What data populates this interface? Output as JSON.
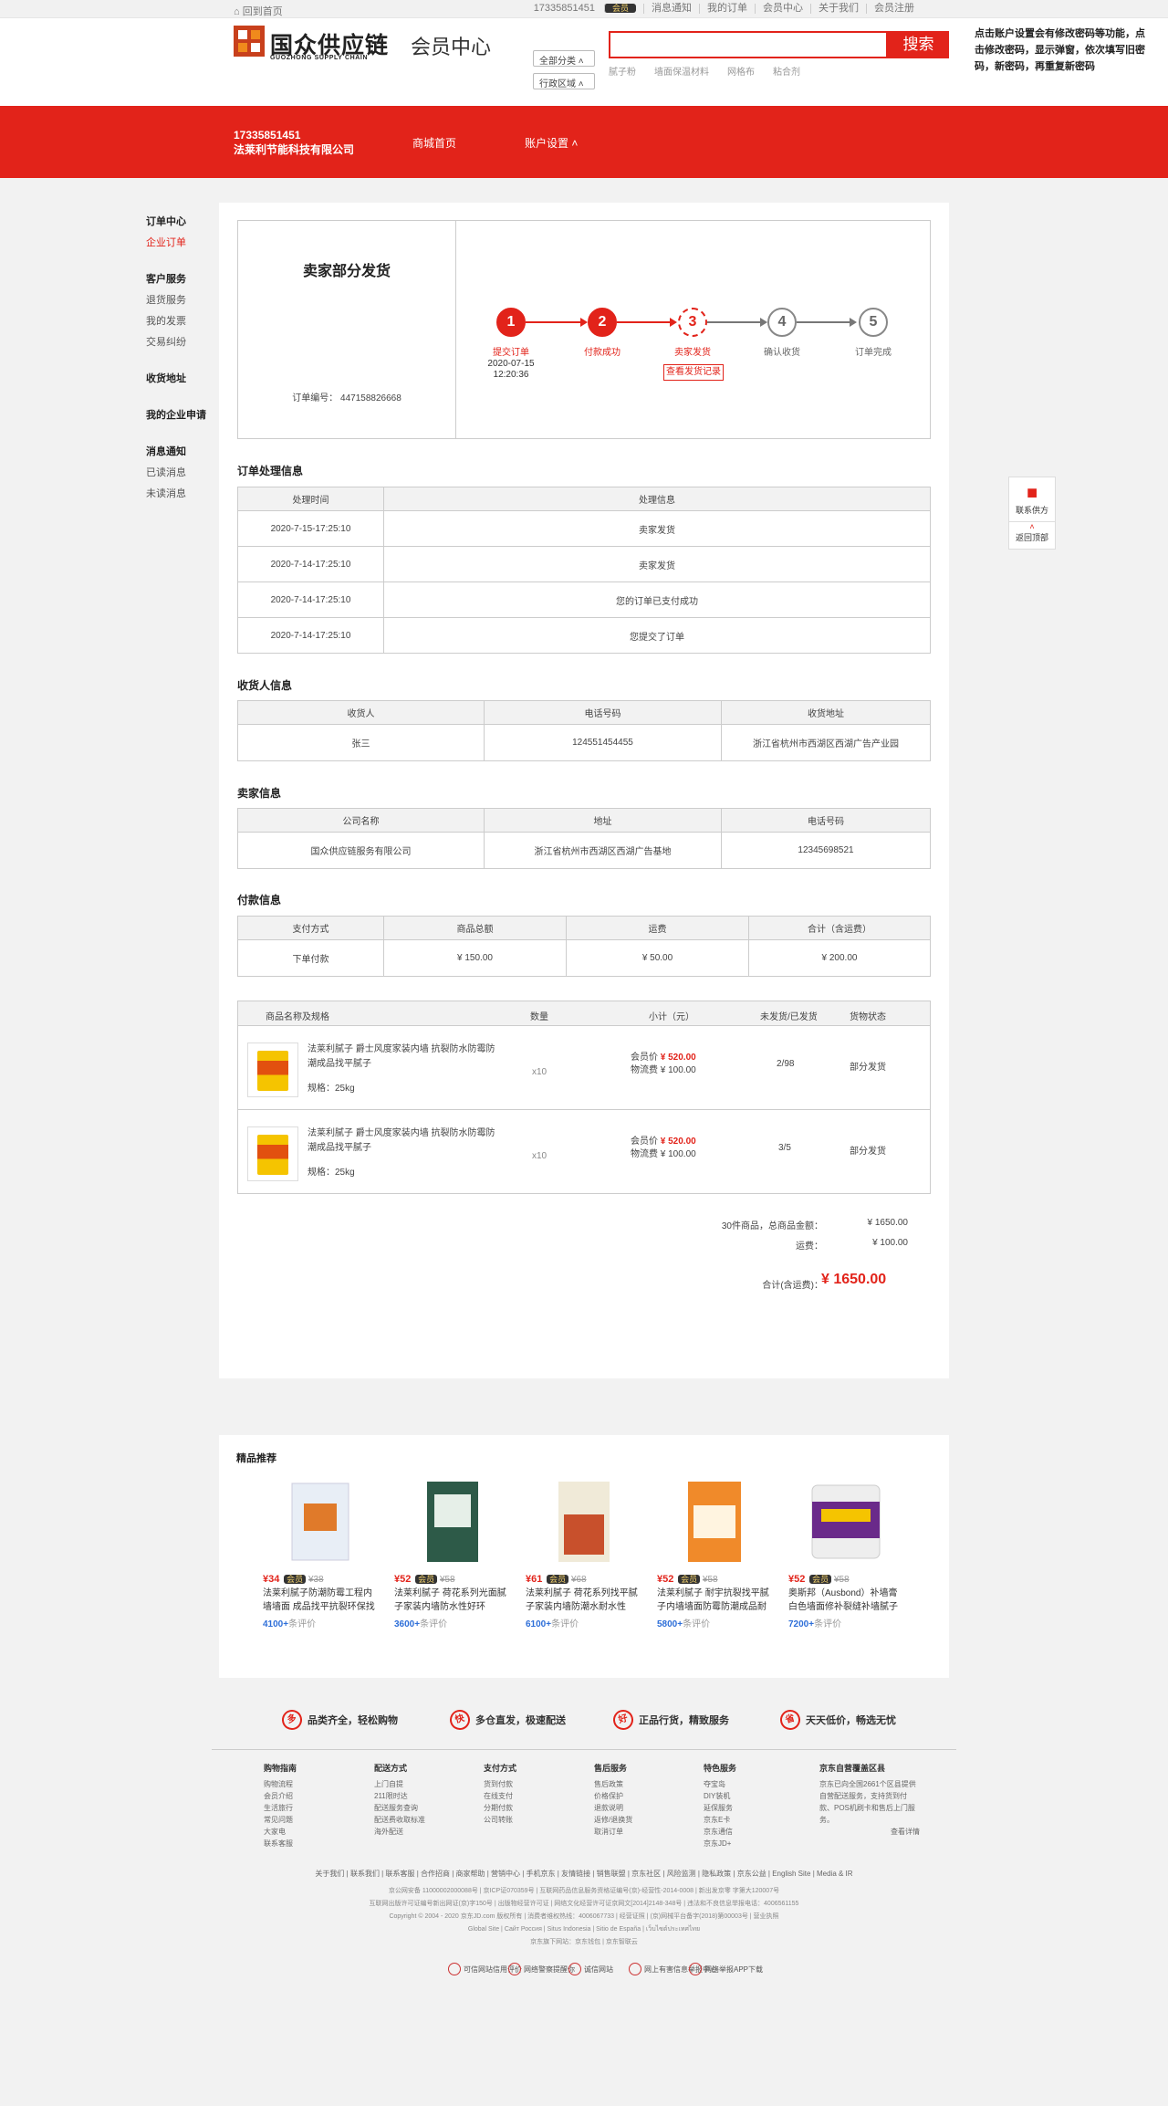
{
  "topbar": {
    "home": "回到首页",
    "phone": "17335851451",
    "vip": "会员",
    "links": [
      "消息通知",
      "我的订单",
      "会员中心",
      "关于我们",
      "会员注册"
    ]
  },
  "header": {
    "logo_cn": "国众供应链",
    "logo_en": "GUOZHONG SUPPLY CHAIN",
    "title": "会员中心",
    "select1": "全部分类",
    "select2": "行政区域",
    "search_btn": "搜索",
    "search_placeholder": "",
    "hot": [
      "腻子粉",
      "墙面保温材料",
      "网格布",
      "粘合剂"
    ],
    "note": "点击账户设置会有修改密码等功能，点击修改密码，显示弹窗，依次填写旧密码，新密码，再重复新密码"
  },
  "account": {
    "phone": "17335851451",
    "company": "法莱利节能科技有限公司",
    "nav": [
      "商城首页",
      "账户设置"
    ]
  },
  "sidebar": [
    {
      "head": "订单中心",
      "items": [
        "企业订单"
      ]
    },
    {
      "head": "客户服务",
      "items": [
        "退货服务",
        "我的发票",
        "交易纠纷"
      ]
    },
    {
      "head": "收货地址",
      "items": []
    },
    {
      "head": "我的企业申请",
      "items": []
    },
    {
      "head": "消息通知",
      "items": [
        "已读消息",
        "未读消息"
      ]
    }
  ],
  "order": {
    "status": "卖家部分发货",
    "order_no_label": "订单编号：",
    "order_no": "447158826668",
    "steps": [
      {
        "n": "1",
        "label": "提交订单"
      },
      {
        "n": "2",
        "label": "付款成功"
      },
      {
        "n": "3",
        "label": "卖家发货"
      },
      {
        "n": "4",
        "label": "确认收货"
      },
      {
        "n": "5",
        "label": "订单完成"
      }
    ],
    "step1_date": "2020-07-15",
    "step1_time": "12:20:36",
    "log_btn": "查看发货记录"
  },
  "process": {
    "title": "订单处理信息",
    "headers": [
      "处理时间",
      "处理信息"
    ],
    "rows": [
      [
        "2020-7-15-17:25:10",
        "卖家发货"
      ],
      [
        "2020-7-14-17:25:10",
        "卖家发货"
      ],
      [
        "2020-7-14-17:25:10",
        "您的订单已支付成功"
      ],
      [
        "2020-7-14-17:25:10",
        "您提交了订单"
      ]
    ]
  },
  "receiver": {
    "title": "收货人信息",
    "headers": [
      "收货人",
      "电话号码",
      "收货地址"
    ],
    "row": [
      "张三",
      "124551454455",
      "浙江省杭州市西湖区西湖广告产业园"
    ]
  },
  "seller": {
    "title": "卖家信息",
    "headers": [
      "公司名称",
      "地址",
      "电话号码"
    ],
    "row": [
      "国众供应链服务有限公司",
      "浙江省杭州市西湖区西湖广告基地",
      "12345698521"
    ]
  },
  "payment": {
    "title": "付款信息",
    "headers": [
      "支付方式",
      "商品总额",
      "运费",
      "合计（含运费）"
    ],
    "row": [
      "下单付款",
      "¥ 150.00",
      "¥ 50.00",
      "¥ 200.00"
    ]
  },
  "products": {
    "headers": [
      "商品名称及规格",
      "数量",
      "小计（元）",
      "未发货/已发货",
      "货物状态"
    ],
    "items": [
      {
        "name": "法莱利腻子 爵士风度家装内墙 抗裂防水防霉防潮成品找平腻子",
        "spec": "规格：25kg",
        "qty": "x10",
        "member_label": "会员价",
        "member_price": "¥ 520.00",
        "logistics_label": "物流费",
        "logistics": "¥ 100.00",
        "ship": "2/98",
        "status": "部分发货"
      },
      {
        "name": "法莱利腻子 爵士风度家装内墙 抗裂防水防霉防潮成品找平腻子",
        "spec": "规格：25kg",
        "qty": "x10",
        "member_label": "会员价",
        "member_price": "¥ 520.00",
        "logistics_label": "物流费",
        "logistics": "¥ 100.00",
        "ship": "3/5",
        "status": "部分发货"
      }
    ]
  },
  "summary": {
    "goods_label": "30件商品，总商品金额：",
    "goods": "¥ 1650.00",
    "freight_label": "运费：",
    "freight": "¥ 100.00",
    "total_label": "合计(含运费)：",
    "total": "¥ 1650.00"
  },
  "recommend": {
    "title": "精品推荐",
    "items": [
      {
        "price": "¥34",
        "old_price": "¥38",
        "name": "法莱利腻子防潮防霉工程内墙墙面 成品找平抗裂环保找平",
        "count": "4100+",
        "count_label": "条评价"
      },
      {
        "price": "¥52",
        "old_price": "¥58",
        "name": "法莱利腻子 荷花系列光面腻子家装内墙防水性好环",
        "count": "3600+",
        "count_label": "条评价"
      },
      {
        "price": "¥61",
        "old_price": "¥68",
        "name": "法莱利腻子 荷花系列找平腻子家装内墙防潮水耐水性",
        "count": "6100+",
        "count_label": "条评价"
      },
      {
        "price": "¥52",
        "old_price": "¥58",
        "name": "法莱利腻子 耐宇抗裂找平腻子内墙墙面防霉防潮成品耐",
        "count": "5800+",
        "count_label": "条评价"
      },
      {
        "price": "¥52",
        "old_price": "¥58",
        "name": "奥斯邦（Ausbond）补墙膏 白色墙面修补裂缝补墙腻子膏粉刷",
        "count": "7200+",
        "count_label": "条评价"
      }
    ],
    "vip": "会员"
  },
  "promises": [
    {
      "icon": "多",
      "text": "品类齐全，轻松购物"
    },
    {
      "icon": "快",
      "text": "多仓直发，极速配送"
    },
    {
      "icon": "好",
      "text": "正品行货，精致服务"
    },
    {
      "icon": "省",
      "text": "天天低价，畅选无忧"
    }
  ],
  "footer_cols": [
    {
      "h": "购物指南",
      "items": [
        "购物流程",
        "会员介绍",
        "生活旅行",
        "常见问题",
        "大家电",
        "联系客服"
      ]
    },
    {
      "h": "配送方式",
      "items": [
        "上门自提",
        "211限时达",
        "配送服务查询",
        "配送费收取标准",
        "海外配送"
      ]
    },
    {
      "h": "支付方式",
      "items": [
        "货到付款",
        "在线支付",
        "分期付款",
        "公司转账"
      ]
    },
    {
      "h": "售后服务",
      "items": [
        "售后政策",
        "价格保护",
        "退款说明",
        "返修/退换货",
        "取消订单"
      ]
    },
    {
      "h": "特色服务",
      "items": [
        "夺宝岛",
        "DIY装机",
        "延保服务",
        "京东E卡",
        "京东通信",
        "京东JD+"
      ]
    },
    {
      "h": "京东自营覆盖区县",
      "items": [
        "京东已向全国2661个区县提供自营配送服务，支持货到付款、POS机刷卡和售后上门服务。",
        "查看详情"
      ]
    }
  ],
  "footer_links": "关于我们 | 联系我们 | 联系客服 | 合作招商 | 商家帮助 | 营销中心 | 手机京东 | 友情链接 | 销售联盟 | 京东社区 | 风险监测 | 隐私政策 | 京东公益 | English Site | Media & IR",
  "footer_lines": [
    "京公网安备 11000002000088号 | 京ICP证070359号 | 互联网药品信息服务资格证编号(京)-经营性-2014-0008 | 新出发京零 字第大120007号",
    "互联网出版许可证编号新出网证(京)字150号 | 出版物经营许可证 | 网络文化经营许可证京网文[2014]2148-348号 | 违法和不良信息举报电话：4006561155",
    "Copyright © 2004 - 2020 京东JD.com 版权所有 | 消费者维权热线：4006067733 | 经营证照 | (京)网械平台备字(2018)第00003号 | 营业执照",
    "Global Site | Сайт Россия | Situs Indonesia | Sitio de España | เว็บไซต์ประเทศไทย",
    "京东旗下网站：京东钱包 | 京东智联云"
  ],
  "badges": [
    "可信网站信用评价",
    "网络警察提醒你",
    "诚信网站",
    "网上有害信息举报中心",
    "网络举报APP下载"
  ],
  "float": {
    "contact": "联系供方",
    "top": "返回顶部"
  }
}
